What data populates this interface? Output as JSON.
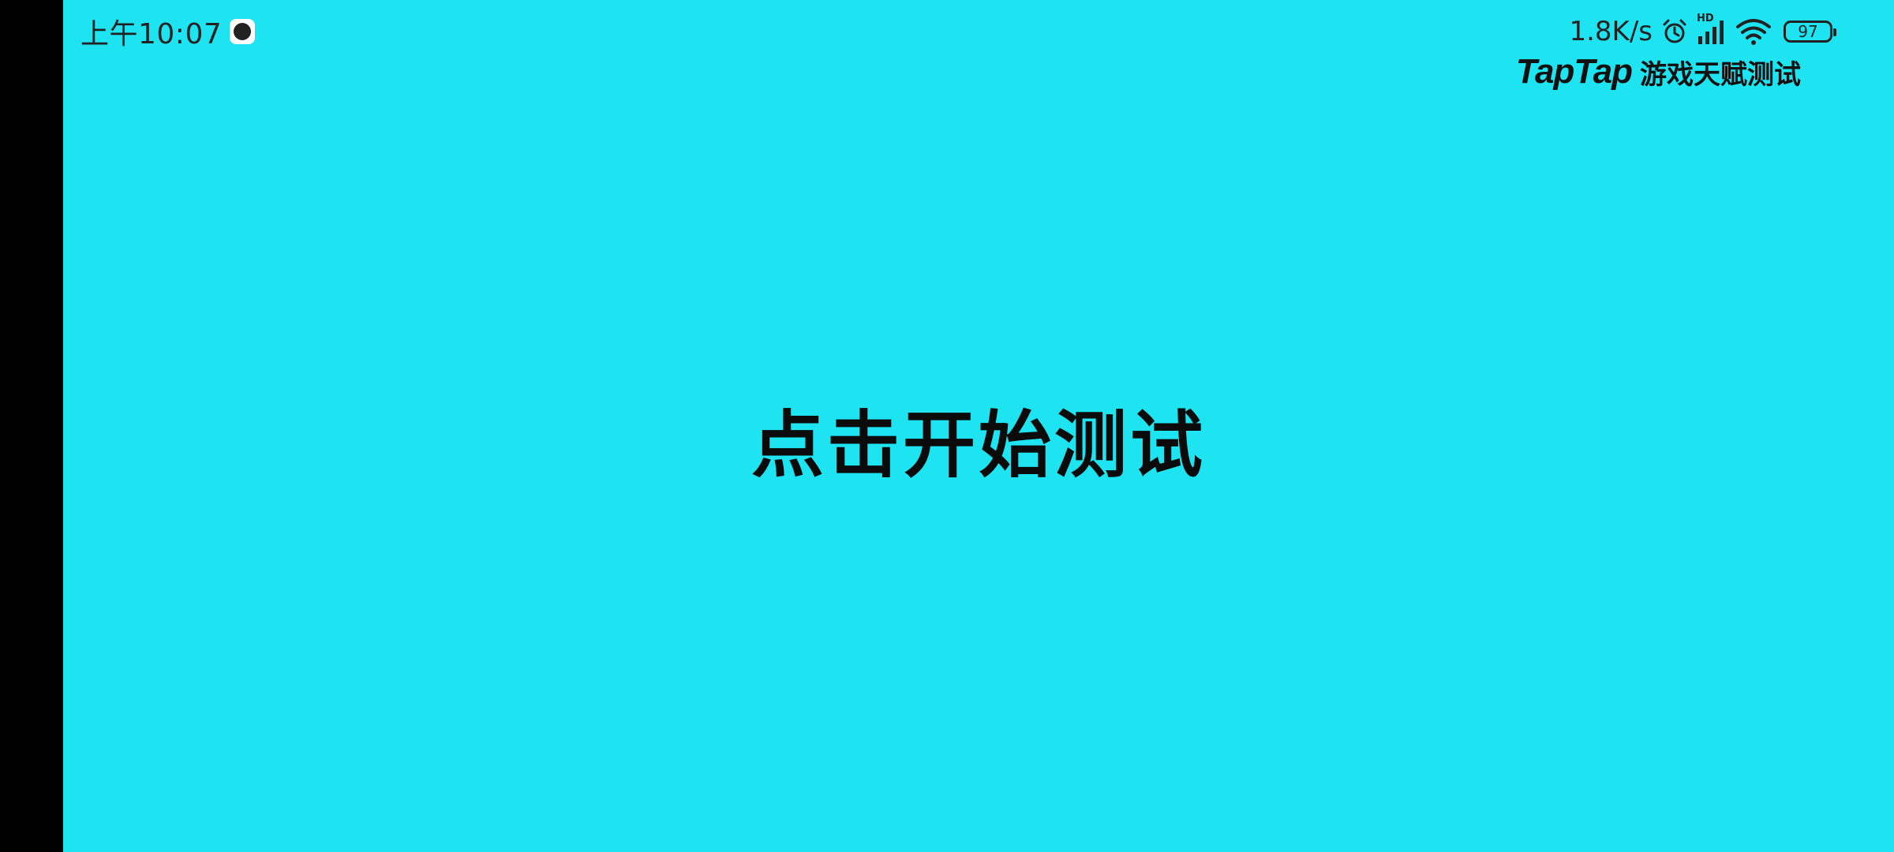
{
  "status_bar": {
    "time": "上午10:07",
    "net_speed": "1.8K/s",
    "signal_label": "HD",
    "battery": "97"
  },
  "brand": {
    "logo": "TapTap",
    "subtitle": "游戏天赋测试"
  },
  "main": {
    "start_label": "点击开始测试"
  },
  "colors": {
    "background": "#1ee4f2",
    "text": "#0b0b0b"
  }
}
